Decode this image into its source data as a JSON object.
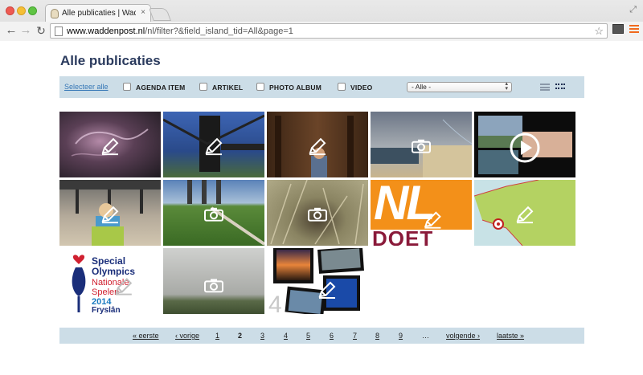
{
  "browser": {
    "tab_title": "Alle publicaties | Waddenp",
    "tab_close": "×",
    "url_host": "www.waddenpost.nl",
    "url_path": "/nl/filter?&field_island_tid=All&page=1"
  },
  "page": {
    "title": "Alle publicaties"
  },
  "filter": {
    "select_all": "Selecteer alle",
    "types": [
      "AGENDA ITEM",
      "ARTIKEL",
      "PHOTO ALBUM",
      "VIDEO"
    ],
    "island_select": "- Alle -"
  },
  "tiles": [
    {
      "type": "article",
      "icon": "pencil-icon",
      "bg": "#3c2c3a"
    },
    {
      "type": "article",
      "icon": "pencil-icon",
      "bg": "#2f4f8a"
    },
    {
      "type": "article",
      "icon": "pencil-icon",
      "bg": "#4a2e1c"
    },
    {
      "type": "photo",
      "icon": "camera-icon",
      "bg": "#8a9098"
    },
    {
      "type": "video",
      "icon": "play-icon",
      "bg": "#101010"
    },
    {
      "type": "article",
      "icon": "pencil-icon",
      "bg": "#9a9082"
    },
    {
      "type": "photo",
      "icon": "camera-icon",
      "bg": "#4f7a34"
    },
    {
      "type": "photo",
      "icon": "camera-icon",
      "bg": "#6e6a52"
    },
    {
      "type": "article",
      "icon": "pencil-icon",
      "bg": "#f39019",
      "text": "NL DOET"
    },
    {
      "type": "article",
      "icon": "pencil-icon",
      "bg": "#c6dde0"
    },
    {
      "type": "article",
      "icon": "pencil-icon",
      "bg": "#ffffff",
      "text": "Special Olympics Nationale Spelen 2014 Fryslân"
    },
    {
      "type": "photo",
      "icon": "camera-icon",
      "bg": "#8e9286"
    },
    {
      "type": "article",
      "icon": "pencil-icon",
      "bg": "#ffffff",
      "text": "4"
    }
  ],
  "pager": {
    "first": "« eerste",
    "prev": "‹ vorige",
    "pages": [
      "1",
      "2",
      "3",
      "4",
      "5",
      "6",
      "7",
      "8",
      "9"
    ],
    "current": "2",
    "ellipsis": "…",
    "next": "volgende ›",
    "last": "laatste »"
  }
}
